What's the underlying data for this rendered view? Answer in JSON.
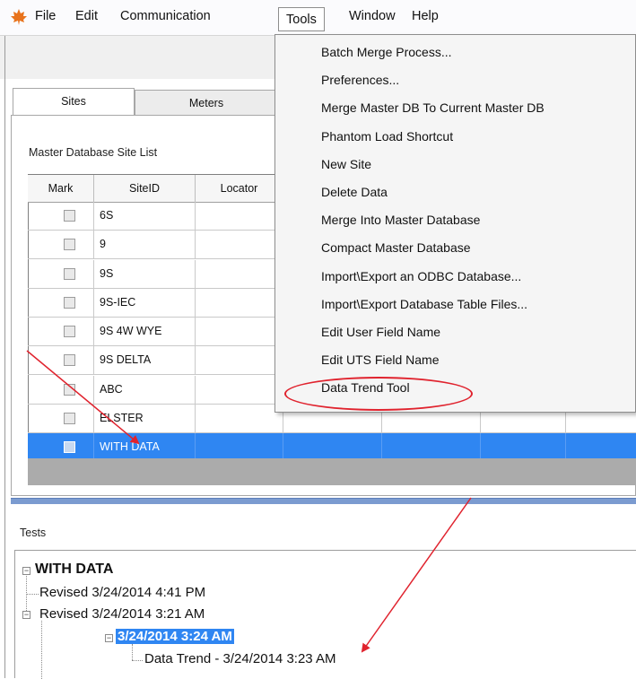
{
  "menubar": {
    "items": [
      "File",
      "Edit",
      "Communication",
      "Tools",
      "Window",
      "Help"
    ],
    "app_icon": "maple-leaf-icon"
  },
  "tabs": [
    "Sites",
    "Meters"
  ],
  "panel_label": "Master Database Site List",
  "grid": {
    "columns": [
      "Mark",
      "SiteID",
      "Locator"
    ],
    "rows": [
      {
        "site_id": "6S",
        "selected": false
      },
      {
        "site_id": "9",
        "selected": false
      },
      {
        "site_id": "9S",
        "selected": false
      },
      {
        "site_id": "9S-IEC",
        "selected": false
      },
      {
        "site_id": "9S 4W WYE",
        "selected": false
      },
      {
        "site_id": "9S DELTA",
        "selected": false
      },
      {
        "site_id": "ABC",
        "selected": false
      },
      {
        "site_id": "ELSTER",
        "selected": false
      },
      {
        "site_id": "WITH DATA",
        "selected": true
      }
    ]
  },
  "tests": {
    "label": "Tests",
    "root": "WITH DATA",
    "revised_1": "Revised 3/24/2014 4:41 PM",
    "revised_2": "Revised 3/24/2014 3:21 AM",
    "selected_node": "3/24/2014 3:24 AM",
    "data_trend": "Data Trend - 3/24/2014 3:23 AM"
  },
  "tools_menu": {
    "items": [
      "Batch Merge Process...",
      "Preferences...",
      "Merge Master DB To Current Master DB",
      "Phantom Load Shortcut",
      "New Site",
      "Delete Data",
      "Merge Into Master Database",
      "Compact Master Database",
      "Import\\Export an ODBC Database...",
      "Import\\Export Database Table Files...",
      "Edit User Field Name",
      "Edit UTS Field Name",
      "Data Trend Tool"
    ],
    "highlighted_item": "Data Trend Tool"
  },
  "colors": {
    "selection": "#2f86f2",
    "annotation": "#e0232e"
  }
}
